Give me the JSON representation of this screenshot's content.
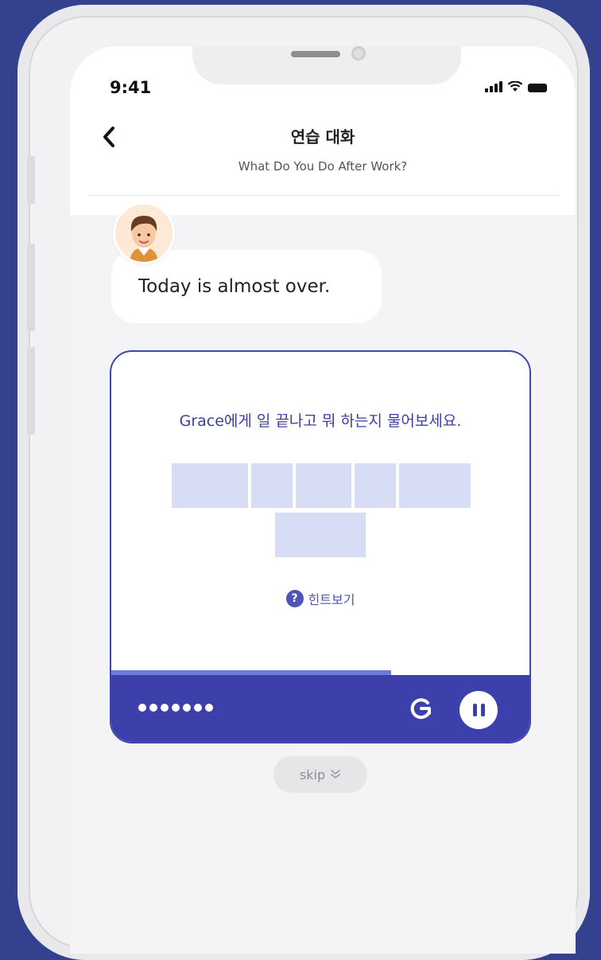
{
  "status_bar": {
    "time": "9:41"
  },
  "header": {
    "title": "연습 대화",
    "subtitle": "What Do You Do After Work?"
  },
  "chat": {
    "bubble_text": "Today is almost over."
  },
  "exercise": {
    "prompt": "Grace에게 일 끝나고 뭐 하는지 물어보세요.",
    "blank_count": 6,
    "hint_label": "힌트보기",
    "progress": 0.67,
    "dot_count": 7
  },
  "skip": {
    "label": "skip"
  },
  "colors": {
    "background": "#33418f",
    "accent": "#3d40ab",
    "blank": "#d8ddf6",
    "progress": "#6f7bdc"
  },
  "icons": {
    "back": "chevron-left-icon",
    "replay": "replay-icon",
    "pause": "pause-icon",
    "hint": "question-icon",
    "skip": "double-chevron-down-icon"
  }
}
